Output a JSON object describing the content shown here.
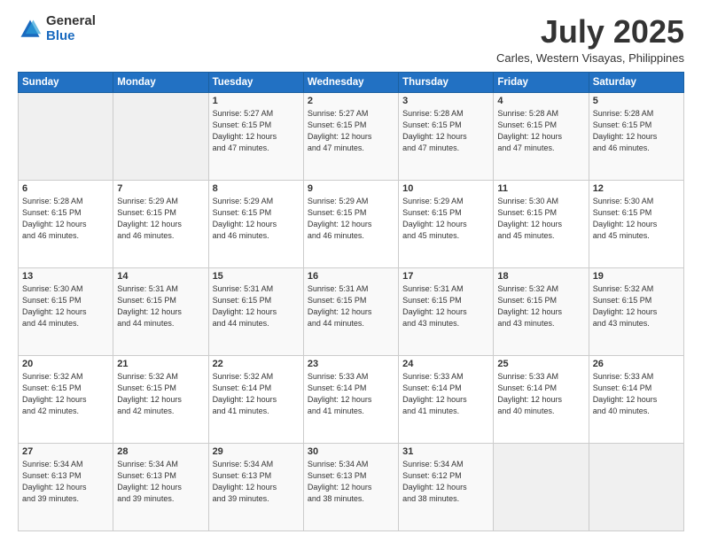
{
  "header": {
    "logo_general": "General",
    "logo_blue": "Blue",
    "month_title": "July 2025",
    "location": "Carles, Western Visayas, Philippines"
  },
  "days_of_week": [
    "Sunday",
    "Monday",
    "Tuesday",
    "Wednesday",
    "Thursday",
    "Friday",
    "Saturday"
  ],
  "weeks": [
    [
      {
        "day": "",
        "empty": true
      },
      {
        "day": "",
        "empty": true
      },
      {
        "day": "1",
        "sunrise": "5:27 AM",
        "sunset": "6:15 PM",
        "daylight": "12 hours and 47 minutes."
      },
      {
        "day": "2",
        "sunrise": "5:27 AM",
        "sunset": "6:15 PM",
        "daylight": "12 hours and 47 minutes."
      },
      {
        "day": "3",
        "sunrise": "5:28 AM",
        "sunset": "6:15 PM",
        "daylight": "12 hours and 47 minutes."
      },
      {
        "day": "4",
        "sunrise": "5:28 AM",
        "sunset": "6:15 PM",
        "daylight": "12 hours and 47 minutes."
      },
      {
        "day": "5",
        "sunrise": "5:28 AM",
        "sunset": "6:15 PM",
        "daylight": "12 hours and 46 minutes."
      }
    ],
    [
      {
        "day": "6",
        "sunrise": "5:28 AM",
        "sunset": "6:15 PM",
        "daylight": "12 hours and 46 minutes."
      },
      {
        "day": "7",
        "sunrise": "5:29 AM",
        "sunset": "6:15 PM",
        "daylight": "12 hours and 46 minutes."
      },
      {
        "day": "8",
        "sunrise": "5:29 AM",
        "sunset": "6:15 PM",
        "daylight": "12 hours and 46 minutes."
      },
      {
        "day": "9",
        "sunrise": "5:29 AM",
        "sunset": "6:15 PM",
        "daylight": "12 hours and 46 minutes."
      },
      {
        "day": "10",
        "sunrise": "5:29 AM",
        "sunset": "6:15 PM",
        "daylight": "12 hours and 45 minutes."
      },
      {
        "day": "11",
        "sunrise": "5:30 AM",
        "sunset": "6:15 PM",
        "daylight": "12 hours and 45 minutes."
      },
      {
        "day": "12",
        "sunrise": "5:30 AM",
        "sunset": "6:15 PM",
        "daylight": "12 hours and 45 minutes."
      }
    ],
    [
      {
        "day": "13",
        "sunrise": "5:30 AM",
        "sunset": "6:15 PM",
        "daylight": "12 hours and 44 minutes."
      },
      {
        "day": "14",
        "sunrise": "5:31 AM",
        "sunset": "6:15 PM",
        "daylight": "12 hours and 44 minutes."
      },
      {
        "day": "15",
        "sunrise": "5:31 AM",
        "sunset": "6:15 PM",
        "daylight": "12 hours and 44 minutes."
      },
      {
        "day": "16",
        "sunrise": "5:31 AM",
        "sunset": "6:15 PM",
        "daylight": "12 hours and 44 minutes."
      },
      {
        "day": "17",
        "sunrise": "5:31 AM",
        "sunset": "6:15 PM",
        "daylight": "12 hours and 43 minutes."
      },
      {
        "day": "18",
        "sunrise": "5:32 AM",
        "sunset": "6:15 PM",
        "daylight": "12 hours and 43 minutes."
      },
      {
        "day": "19",
        "sunrise": "5:32 AM",
        "sunset": "6:15 PM",
        "daylight": "12 hours and 43 minutes."
      }
    ],
    [
      {
        "day": "20",
        "sunrise": "5:32 AM",
        "sunset": "6:15 PM",
        "daylight": "12 hours and 42 minutes."
      },
      {
        "day": "21",
        "sunrise": "5:32 AM",
        "sunset": "6:15 PM",
        "daylight": "12 hours and 42 minutes."
      },
      {
        "day": "22",
        "sunrise": "5:32 AM",
        "sunset": "6:14 PM",
        "daylight": "12 hours and 41 minutes."
      },
      {
        "day": "23",
        "sunrise": "5:33 AM",
        "sunset": "6:14 PM",
        "daylight": "12 hours and 41 minutes."
      },
      {
        "day": "24",
        "sunrise": "5:33 AM",
        "sunset": "6:14 PM",
        "daylight": "12 hours and 41 minutes."
      },
      {
        "day": "25",
        "sunrise": "5:33 AM",
        "sunset": "6:14 PM",
        "daylight": "12 hours and 40 minutes."
      },
      {
        "day": "26",
        "sunrise": "5:33 AM",
        "sunset": "6:14 PM",
        "daylight": "12 hours and 40 minutes."
      }
    ],
    [
      {
        "day": "27",
        "sunrise": "5:34 AM",
        "sunset": "6:13 PM",
        "daylight": "12 hours and 39 minutes."
      },
      {
        "day": "28",
        "sunrise": "5:34 AM",
        "sunset": "6:13 PM",
        "daylight": "12 hours and 39 minutes."
      },
      {
        "day": "29",
        "sunrise": "5:34 AM",
        "sunset": "6:13 PM",
        "daylight": "12 hours and 39 minutes."
      },
      {
        "day": "30",
        "sunrise": "5:34 AM",
        "sunset": "6:13 PM",
        "daylight": "12 hours and 38 minutes."
      },
      {
        "day": "31",
        "sunrise": "5:34 AM",
        "sunset": "6:12 PM",
        "daylight": "12 hours and 38 minutes."
      },
      {
        "day": "",
        "empty": true
      },
      {
        "day": "",
        "empty": true
      }
    ]
  ],
  "labels": {
    "sunrise": "Sunrise:",
    "sunset": "Sunset:",
    "daylight": "Daylight:"
  }
}
